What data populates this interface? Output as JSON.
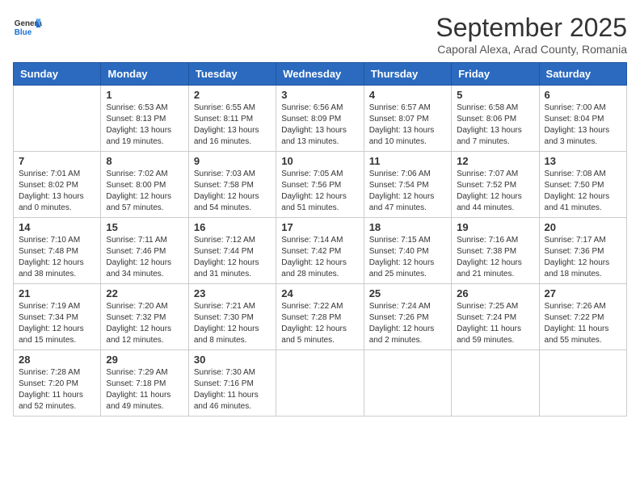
{
  "header": {
    "logo": {
      "general": "General",
      "blue": "Blue"
    },
    "month": "September 2025",
    "location": "Caporal Alexa, Arad County, Romania"
  },
  "weekdays": [
    "Sunday",
    "Monday",
    "Tuesday",
    "Wednesday",
    "Thursday",
    "Friday",
    "Saturday"
  ],
  "weeks": [
    [
      {
        "day": null
      },
      {
        "day": 1,
        "sunrise": "6:53 AM",
        "sunset": "8:13 PM",
        "daylight": "13 hours and 19 minutes."
      },
      {
        "day": 2,
        "sunrise": "6:55 AM",
        "sunset": "8:11 PM",
        "daylight": "13 hours and 16 minutes."
      },
      {
        "day": 3,
        "sunrise": "6:56 AM",
        "sunset": "8:09 PM",
        "daylight": "13 hours and 13 minutes."
      },
      {
        "day": 4,
        "sunrise": "6:57 AM",
        "sunset": "8:07 PM",
        "daylight": "13 hours and 10 minutes."
      },
      {
        "day": 5,
        "sunrise": "6:58 AM",
        "sunset": "8:06 PM",
        "daylight": "13 hours and 7 minutes."
      },
      {
        "day": 6,
        "sunrise": "7:00 AM",
        "sunset": "8:04 PM",
        "daylight": "13 hours and 3 minutes."
      }
    ],
    [
      {
        "day": 7,
        "sunrise": "7:01 AM",
        "sunset": "8:02 PM",
        "daylight": "13 hours and 0 minutes."
      },
      {
        "day": 8,
        "sunrise": "7:02 AM",
        "sunset": "8:00 PM",
        "daylight": "12 hours and 57 minutes."
      },
      {
        "day": 9,
        "sunrise": "7:03 AM",
        "sunset": "7:58 PM",
        "daylight": "12 hours and 54 minutes."
      },
      {
        "day": 10,
        "sunrise": "7:05 AM",
        "sunset": "7:56 PM",
        "daylight": "12 hours and 51 minutes."
      },
      {
        "day": 11,
        "sunrise": "7:06 AM",
        "sunset": "7:54 PM",
        "daylight": "12 hours and 47 minutes."
      },
      {
        "day": 12,
        "sunrise": "7:07 AM",
        "sunset": "7:52 PM",
        "daylight": "12 hours and 44 minutes."
      },
      {
        "day": 13,
        "sunrise": "7:08 AM",
        "sunset": "7:50 PM",
        "daylight": "12 hours and 41 minutes."
      }
    ],
    [
      {
        "day": 14,
        "sunrise": "7:10 AM",
        "sunset": "7:48 PM",
        "daylight": "12 hours and 38 minutes."
      },
      {
        "day": 15,
        "sunrise": "7:11 AM",
        "sunset": "7:46 PM",
        "daylight": "12 hours and 34 minutes."
      },
      {
        "day": 16,
        "sunrise": "7:12 AM",
        "sunset": "7:44 PM",
        "daylight": "12 hours and 31 minutes."
      },
      {
        "day": 17,
        "sunrise": "7:14 AM",
        "sunset": "7:42 PM",
        "daylight": "12 hours and 28 minutes."
      },
      {
        "day": 18,
        "sunrise": "7:15 AM",
        "sunset": "7:40 PM",
        "daylight": "12 hours and 25 minutes."
      },
      {
        "day": 19,
        "sunrise": "7:16 AM",
        "sunset": "7:38 PM",
        "daylight": "12 hours and 21 minutes."
      },
      {
        "day": 20,
        "sunrise": "7:17 AM",
        "sunset": "7:36 PM",
        "daylight": "12 hours and 18 minutes."
      }
    ],
    [
      {
        "day": 21,
        "sunrise": "7:19 AM",
        "sunset": "7:34 PM",
        "daylight": "12 hours and 15 minutes."
      },
      {
        "day": 22,
        "sunrise": "7:20 AM",
        "sunset": "7:32 PM",
        "daylight": "12 hours and 12 minutes."
      },
      {
        "day": 23,
        "sunrise": "7:21 AM",
        "sunset": "7:30 PM",
        "daylight": "12 hours and 8 minutes."
      },
      {
        "day": 24,
        "sunrise": "7:22 AM",
        "sunset": "7:28 PM",
        "daylight": "12 hours and 5 minutes."
      },
      {
        "day": 25,
        "sunrise": "7:24 AM",
        "sunset": "7:26 PM",
        "daylight": "12 hours and 2 minutes."
      },
      {
        "day": 26,
        "sunrise": "7:25 AM",
        "sunset": "7:24 PM",
        "daylight": "11 hours and 59 minutes."
      },
      {
        "day": 27,
        "sunrise": "7:26 AM",
        "sunset": "7:22 PM",
        "daylight": "11 hours and 55 minutes."
      }
    ],
    [
      {
        "day": 28,
        "sunrise": "7:28 AM",
        "sunset": "7:20 PM",
        "daylight": "11 hours and 52 minutes."
      },
      {
        "day": 29,
        "sunrise": "7:29 AM",
        "sunset": "7:18 PM",
        "daylight": "11 hours and 49 minutes."
      },
      {
        "day": 30,
        "sunrise": "7:30 AM",
        "sunset": "7:16 PM",
        "daylight": "11 hours and 46 minutes."
      },
      {
        "day": null
      },
      {
        "day": null
      },
      {
        "day": null
      },
      {
        "day": null
      }
    ]
  ],
  "labels": {
    "sunrise": "Sunrise:",
    "sunset": "Sunset:",
    "daylight": "Daylight:"
  }
}
